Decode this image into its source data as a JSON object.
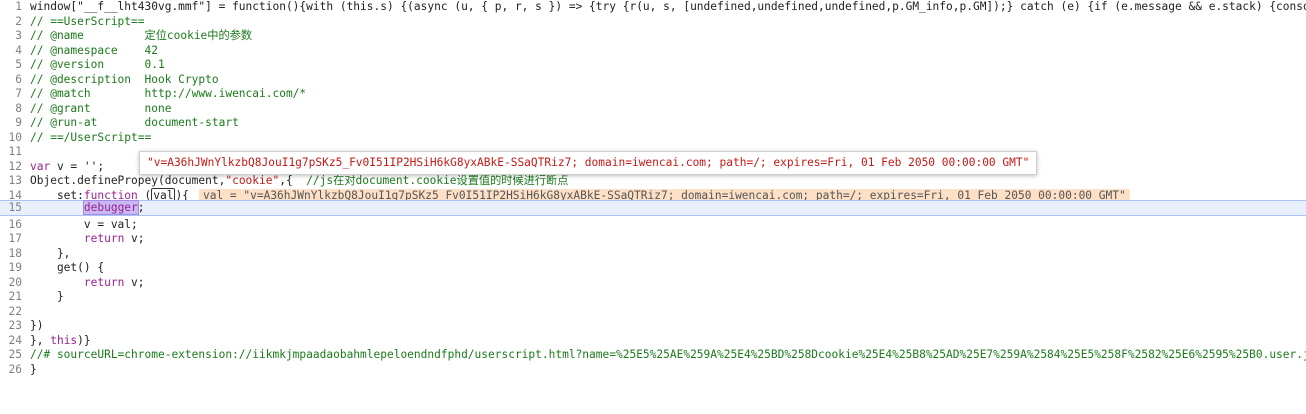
{
  "editor": {
    "current_line": 15,
    "lines": [
      {
        "n": "1",
        "text": "window[\"__f__lht430vg.mmf\"] = function(){with (this.s) {(async (u, { p, r, s }) => {try {r(u, s, [undefined,undefined,undefined,p.GM_info,p.GM]);} catch (e) {if (e.message && e.stack) {console.e"
      },
      {
        "n": "2",
        "text": "// ==UserScript=="
      },
      {
        "n": "3",
        "text": "// @name         定位cookie中的参数"
      },
      {
        "n": "4",
        "text": "// @namespace    42"
      },
      {
        "n": "5",
        "text": "// @version      0.1"
      },
      {
        "n": "6",
        "text": "// @description  Hook Crypto"
      },
      {
        "n": "7",
        "text": "// @match        http://www.iwencai.com/*"
      },
      {
        "n": "8",
        "text": "// @grant        none"
      },
      {
        "n": "9",
        "text": "// @run-at       document-start"
      },
      {
        "n": "10",
        "text": "// ==/UserScript=="
      },
      {
        "n": "11",
        "text": ""
      },
      {
        "n": "12",
        "text_kw": "var",
        "text_rest": " v = '';"
      },
      {
        "n": "13",
        "text_a": "Object.definePrope",
        "text_b": "y(document,",
        "text_str": "\"cookie\"",
        "text_c": ",{  ",
        "text_cm": "//js在对document.cookie设置值的时候进行断点"
      },
      {
        "n": "14",
        "text_indent": "    set:",
        "text_kw": "function",
        "text_mid": " (",
        "text_val": "val",
        "text_end": "){"
      },
      {
        "n": "15",
        "text_indent": "        ",
        "text_debugger": "debugger",
        "text_end": ";"
      },
      {
        "n": "16",
        "text": "        v = val;"
      },
      {
        "n": "17",
        "text_indent": "        ",
        "text_kw": "return",
        "text_rest": " v;"
      },
      {
        "n": "18",
        "text": "    },"
      },
      {
        "n": "19",
        "text": "    get() {"
      },
      {
        "n": "20",
        "text_indent": "        ",
        "text_kw": "return",
        "text_rest": " v;"
      },
      {
        "n": "21",
        "text": "    }"
      },
      {
        "n": "22",
        "text": ""
      },
      {
        "n": "23",
        "text": "})"
      },
      {
        "n": "24",
        "text_a": "}, ",
        "text_kw": "this",
        "text_b": ")}"
      },
      {
        "n": "25",
        "text": "//# sourceURL=chrome-extension://iikmkjmpaadaobahmlepeloendndfphd/userscript.html?name=%25E5%25AE%259A%25E4%25BD%258Dcookie%25E4%25B8%25AD%25E7%259A%2584%25E5%258F%2582%25E6%2595%25B0.user.js&id"
      },
      {
        "n": "26",
        "text": "}"
      }
    ],
    "inline_value": "val = \"v=A36hJWnYlkzbQ8JouI1g7pSKz5_Fv0I51IP2HSiH6kG8yxABkE-SSaQTRiz7; domain=iwencai.com; path=/; expires=Fri, 01 Feb 2050 00:00:00 GMT\"",
    "hover_tooltip": "\"v=A36hJWnYlkzbQ8JouI1g7pSKz5_Fv0I51IP2HSiH6kG8yxABkE-SSaQTRiz7; domain=iwencai.com; path=/; expires=Fri, 01 Feb 2050 00:00:00 GMT\""
  },
  "colors": {
    "keyword": "#9b2393",
    "string": "#c41a16",
    "comment": "#1c7a1c",
    "current_line_bg": "#e8f0fe",
    "inline_value_bg": "#fde0c6"
  }
}
